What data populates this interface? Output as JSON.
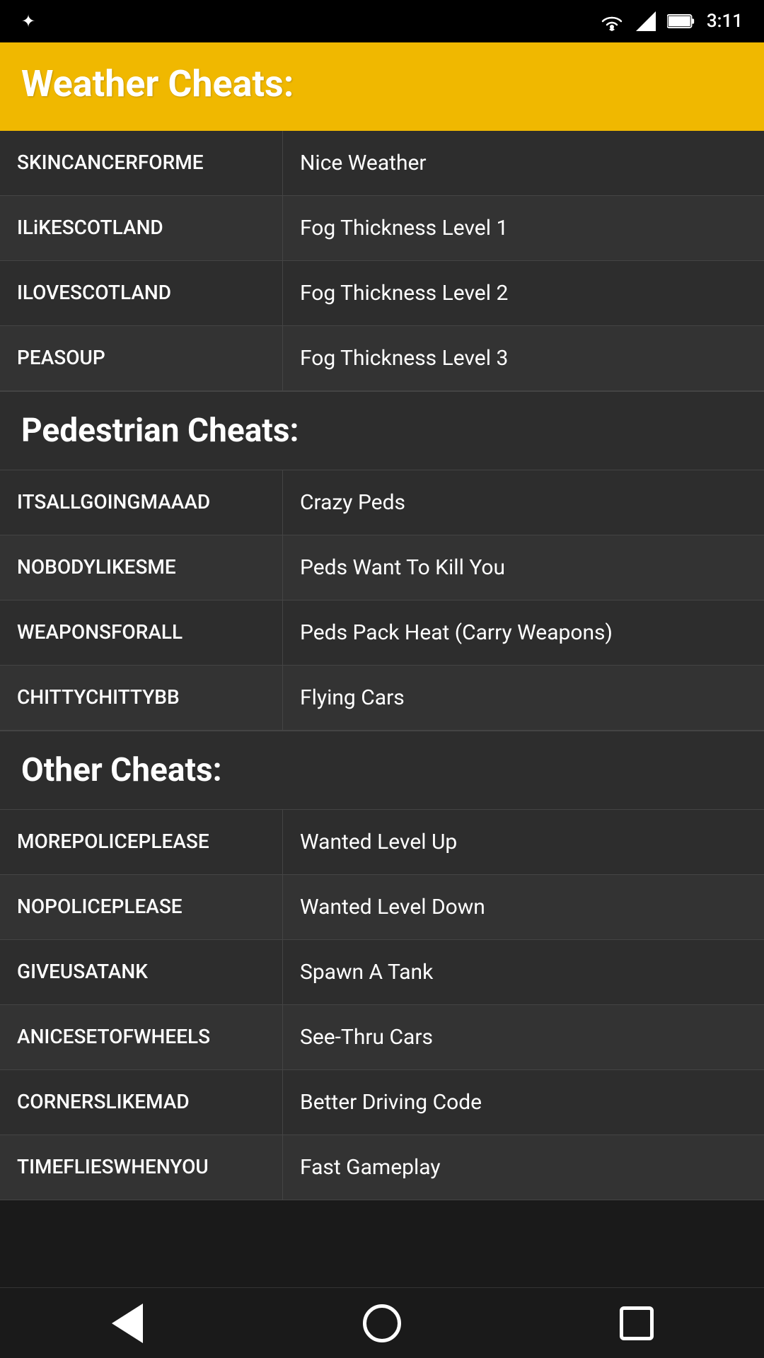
{
  "statusBar": {
    "time": "3:11"
  },
  "header": {
    "title": "Weather Cheats:"
  },
  "weatherCheats": {
    "rows": [
      {
        "code": "SKINCANCERFORME",
        "description": "Nice Weather"
      },
      {
        "code": "ILiKESCOTLAND",
        "description": "Fog Thickness Level 1"
      },
      {
        "code": "ILOVESCOTLAND",
        "description": "Fog Thickness Level 2"
      },
      {
        "code": "PEASOUP",
        "description": "Fog Thickness Level 3"
      }
    ]
  },
  "pedestrianSection": {
    "title": "Pedestrian Cheats:",
    "rows": [
      {
        "code": "ITSALLGOINGMAAAD",
        "description": "Crazy Peds"
      },
      {
        "code": "NOBODYLIKESME",
        "description": "Peds Want To Kill You"
      },
      {
        "code": "WEAPONSFORALL",
        "description": "Peds Pack Heat (Carry Weapons)"
      },
      {
        "code": "CHITTYCHITTYBB",
        "description": "Flying Cars"
      }
    ]
  },
  "otherSection": {
    "title": "Other Cheats:",
    "rows": [
      {
        "code": "MOREPOLICEPLEASE",
        "description": "Wanted Level Up"
      },
      {
        "code": "NOPOLICEPLEASE",
        "description": "Wanted Level Down"
      },
      {
        "code": "GIVEUSATANK",
        "description": "Spawn A Tank"
      },
      {
        "code": "ANICESETOFWHEELS",
        "description": "See-Thru Cars"
      },
      {
        "code": "CORNERSLIKEMAD",
        "description": "Better Driving Code"
      },
      {
        "code": "TIMEFLIESWHENYOU",
        "description": "Fast Gameplay"
      }
    ]
  }
}
